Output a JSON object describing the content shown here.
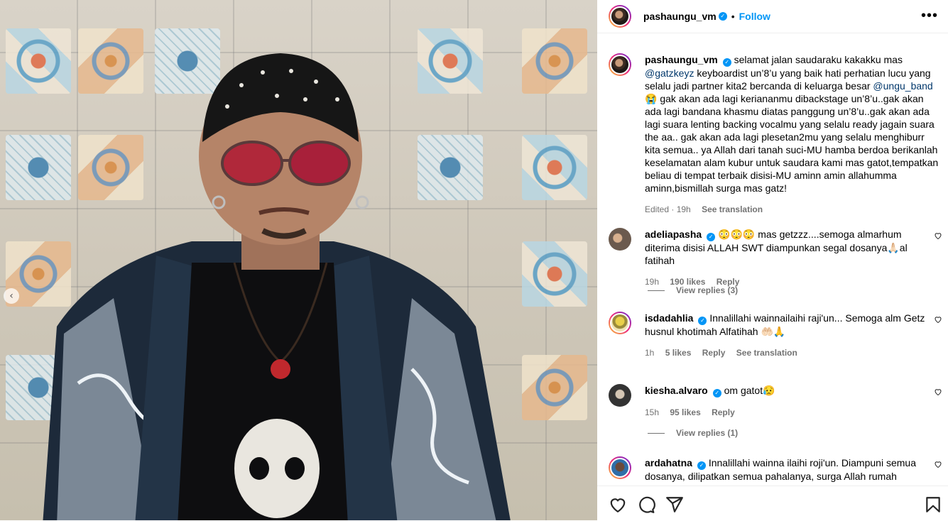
{
  "post": {
    "username": "pashaungu_vm",
    "follow_label": "Follow",
    "more_label": "•••",
    "dot": "•"
  },
  "caption": {
    "username": "pashaungu_vm",
    "text_1": "selamat jalan saudaraku kakakku mas ",
    "mention_1": "@gatzkeyz",
    "text_2": " keyboardist un’8’u yang baik hati perhatian lucu yang selalu jadi partner kita2 bercanda di keluarga besar ",
    "mention_2": "@ungu_band",
    "text_3": " 😭 gak akan ada lagi keriananmu dibackstage un’8’u..gak akan ada lagi bandana khasmu diatas panggung un’8’u..gak akan ada lagi suara lenting backing vocalmu yang selalu ready jagain suara the aa.. gak akan ada lagi plesetan2mu yang selalu menghiburr kita semua.. ya Allah dari tanah suci-MU hamba berdoa berikanlah keselamatan alam kubur untuk saudara kami mas gatot,tempatkan beliau di tempat terbaik disisi-MU aminn amin allahumma aminn,bismillah surga mas gatz!",
    "edited": "Edited · 19h",
    "see_translation": "See translation"
  },
  "comments": [
    {
      "username": "adeliapasha",
      "text": "😳😳😳 mas getzzz....semoga almarhum diterima disisi ALLAH SWT diampunkan segal dosanya🙏🏻al fatihah",
      "time": "19h",
      "likes": "190 likes",
      "reply": "Reply",
      "view_replies": "View replies (3)"
    },
    {
      "username": "isdadahlia",
      "text": "Innalillahi wainnailaihi raji'un... Semoga alm Getz husnul khotimah Alfatihah 🤲🏻🙏",
      "time": "1h",
      "likes": "5 likes",
      "reply": "Reply",
      "see_translation": "See translation"
    },
    {
      "username": "kiesha.alvaro",
      "text": "om gatot😥",
      "time": "15h",
      "likes": "95 likes",
      "reply": "Reply",
      "view_replies": "View replies (1)"
    },
    {
      "username": "ardahatna",
      "text": "Innalillahi wainna ilaihi roji'un. Diampuni semua dosanya, dilipatkan semua pahalanya, surga Allah rumah"
    }
  ],
  "icons": {
    "like": "heart-icon",
    "comment": "comment-icon",
    "share": "share-icon",
    "save": "bookmark-icon",
    "slide_prev": "chevron-left-icon"
  },
  "colors": {
    "link": "#0095f6",
    "mention": "#00376b",
    "muted": "#737373"
  },
  "slide_arrow": "‹"
}
